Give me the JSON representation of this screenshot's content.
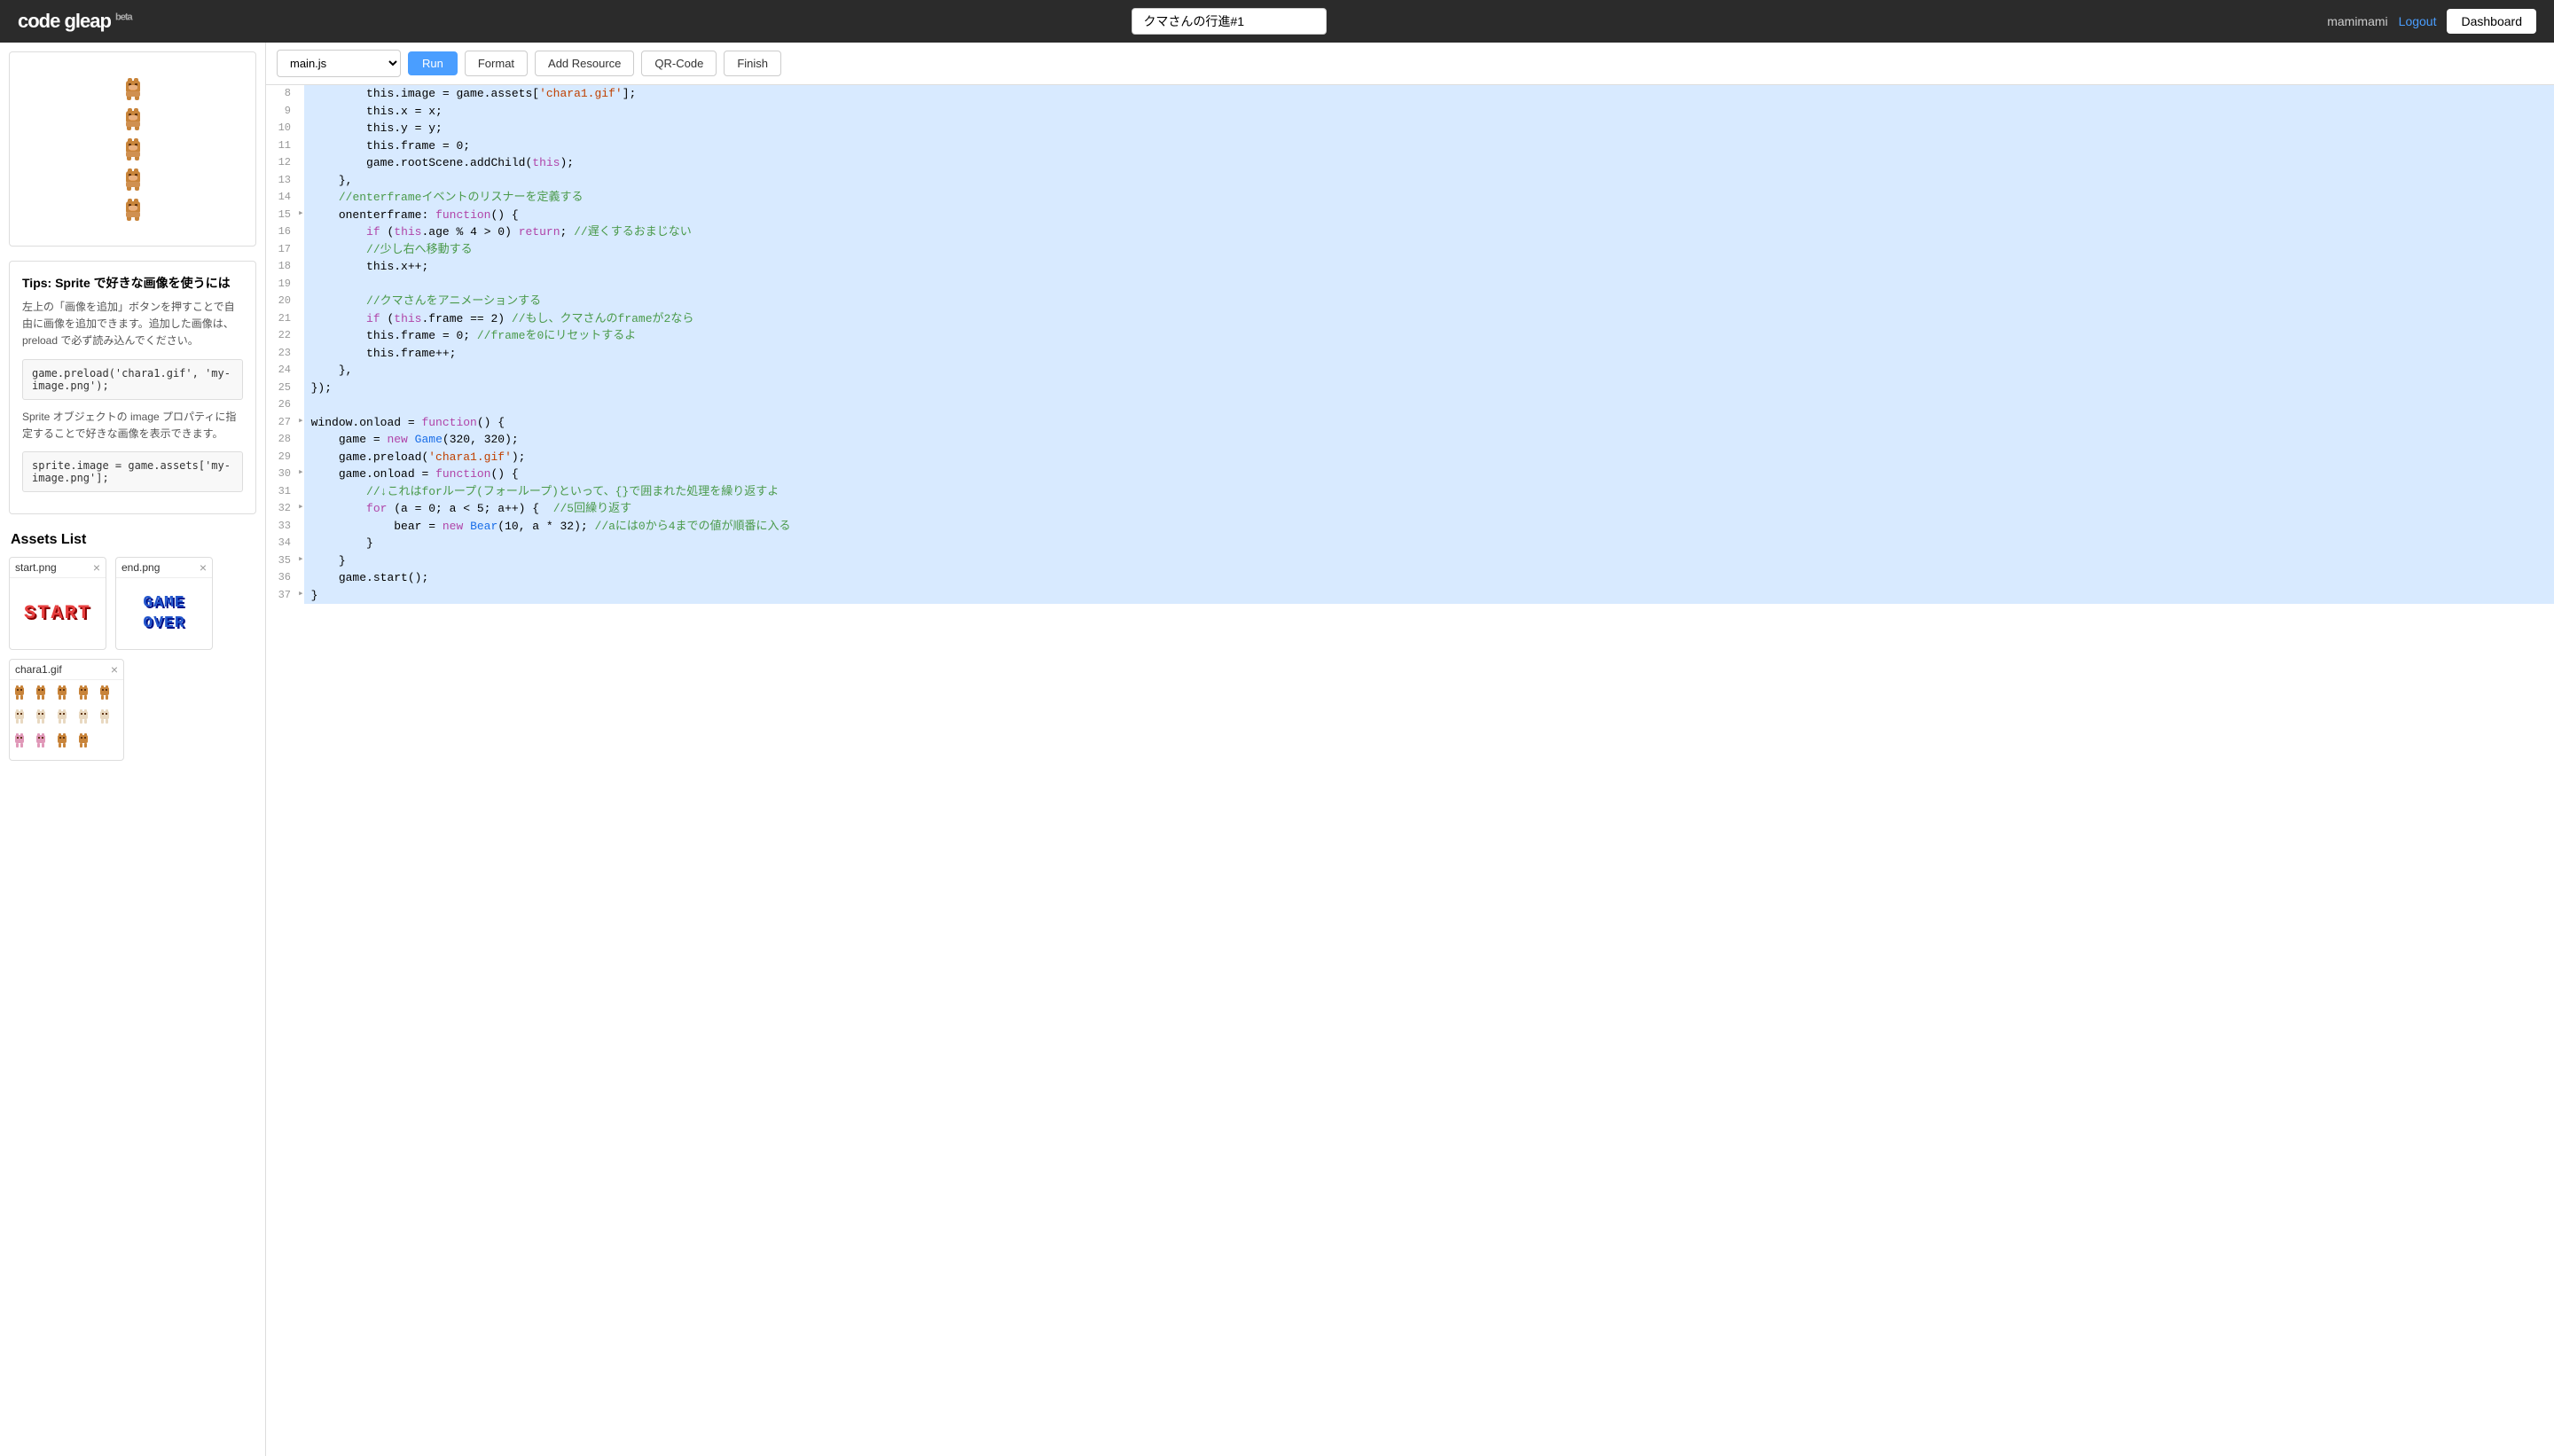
{
  "header": {
    "logo": "code gleap",
    "logo_beta": "beta",
    "title": "クマさんの行進#1",
    "username": "mamimami",
    "logout_label": "Logout",
    "dashboard_label": "Dashboard"
  },
  "editor": {
    "file_label": "main.js",
    "buttons": {
      "run": "Run",
      "format": "Format",
      "add_resource": "Add Resource",
      "qr_code": "QR-Code",
      "finish": "Finish"
    }
  },
  "tips": {
    "title": "Tips: Sprite で好きな画像を使うには",
    "text1": "左上の「画像を追加」ボタンを押すことで自由に画像を追加できます。追加した画像は、preload で必ず読み込んでください。",
    "snippet1": "game.preload('chara1.gif', 'my-image.png');",
    "text2": "Sprite オブジェクトの image プロパティに指定することで好きな画像を表示できます。",
    "snippet2": "sprite.image = game.assets['my-image.png'];"
  },
  "assets": {
    "title": "Assets List",
    "items": [
      {
        "name": "start.png",
        "type": "start"
      },
      {
        "name": "end.png",
        "type": "gameover"
      },
      {
        "name": "chara1.gif",
        "type": "bears"
      }
    ]
  },
  "code": {
    "lines": [
      {
        "num": 8,
        "arrow": false,
        "content": "        this.image = game.assets['chara1.gif'];"
      },
      {
        "num": 9,
        "arrow": false,
        "content": "        this.x = x;"
      },
      {
        "num": 10,
        "arrow": false,
        "content": "        this.y = y;"
      },
      {
        "num": 11,
        "arrow": false,
        "content": "        this.frame = 0;"
      },
      {
        "num": 12,
        "arrow": false,
        "content": "        game.rootScene.addChild(this);"
      },
      {
        "num": 13,
        "arrow": false,
        "content": "    },"
      },
      {
        "num": 14,
        "arrow": false,
        "content": "    //enterframeイベントのリスナーを定義する"
      },
      {
        "num": 15,
        "arrow": true,
        "content": "    onenterframe: function() {"
      },
      {
        "num": 16,
        "arrow": false,
        "content": "        if (this.age % 4 > 0) return; //遅くするおまじない"
      },
      {
        "num": 17,
        "arrow": false,
        "content": "        //少し右へ移動する"
      },
      {
        "num": 18,
        "arrow": false,
        "content": "        this.x++;"
      },
      {
        "num": 19,
        "arrow": false,
        "content": ""
      },
      {
        "num": 20,
        "arrow": false,
        "content": "        //クマさんをアニメーションする"
      },
      {
        "num": 21,
        "arrow": false,
        "content": "        if (this.frame == 2) //もし、クマさんのframeが2なら"
      },
      {
        "num": 22,
        "arrow": false,
        "content": "        this.frame = 0; //frameを0にリセットするよ"
      },
      {
        "num": 23,
        "arrow": false,
        "content": "        this.frame++;"
      },
      {
        "num": 24,
        "arrow": false,
        "content": "    },"
      },
      {
        "num": 25,
        "arrow": false,
        "content": "});"
      },
      {
        "num": 26,
        "arrow": false,
        "content": ""
      },
      {
        "num": 27,
        "arrow": true,
        "content": "window.onload = function() {"
      },
      {
        "num": 28,
        "arrow": false,
        "content": "    game = new Game(320, 320);"
      },
      {
        "num": 29,
        "arrow": false,
        "content": "    game.preload('chara1.gif');"
      },
      {
        "num": 30,
        "arrow": true,
        "content": "    game.onload = function() {"
      },
      {
        "num": 31,
        "arrow": false,
        "content": "        //↓これはforループ(フォーループ)といって、{}で囲まれた処理を繰り返すよ"
      },
      {
        "num": 32,
        "arrow": true,
        "content": "        for (a = 0; a < 5; a++) {  //5回繰り返す"
      },
      {
        "num": 33,
        "arrow": false,
        "content": "            bear = new Bear(10, a * 32); //aには0から4までの値が順番に入る"
      },
      {
        "num": 34,
        "arrow": false,
        "content": "        }"
      },
      {
        "num": 35,
        "arrow": true,
        "content": "    }"
      },
      {
        "num": 36,
        "arrow": false,
        "content": "    game.start();"
      },
      {
        "num": 37,
        "arrow": true,
        "content": "}"
      }
    ]
  }
}
